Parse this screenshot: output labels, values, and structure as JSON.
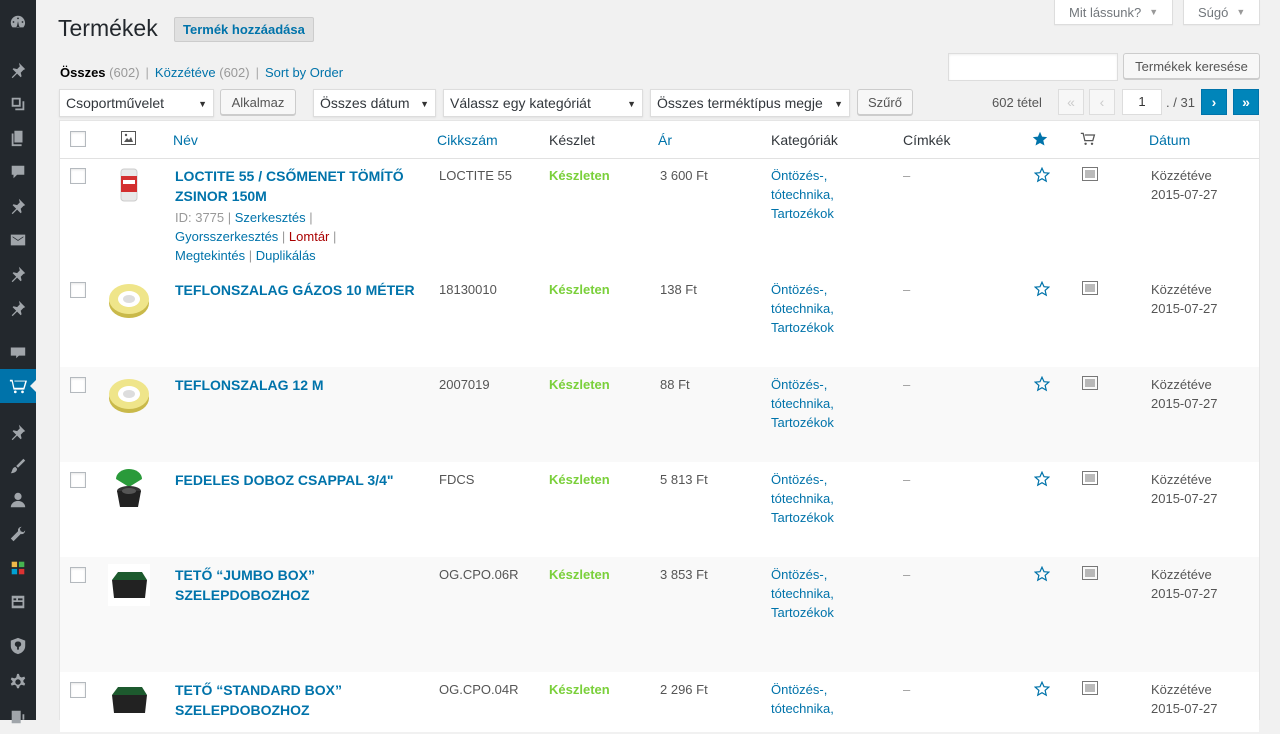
{
  "header": {
    "title": "Termékek",
    "add_new": "Termék hozzáadása",
    "screen_options": "Mit lássunk?",
    "help": "Súgó"
  },
  "views": {
    "all_label": "Összes",
    "all_count": "(602)",
    "published_label": "Közzétéve",
    "published_count": "(602)",
    "sort_label": "Sort by Order"
  },
  "search": {
    "button": "Termékek keresése",
    "value": ""
  },
  "filters": {
    "bulk_action": "Csoportművelet",
    "apply": "Alkalmaz",
    "dates": "Összes dátum",
    "category": "Válassz egy kategóriát",
    "product_type": "Összes terméktípus megje",
    "filter": "Szűrő"
  },
  "pagination": {
    "items": "602 tétel",
    "first": "«",
    "prev": "‹",
    "current_page": "1",
    "total": "/ 31",
    "next": "›",
    "last": "»"
  },
  "columns": {
    "name": "Név",
    "sku": "Cikkszám",
    "stock": "Készlet",
    "price": "Ár",
    "categories": "Kategóriák",
    "tags": "Címkék",
    "date": "Dátum"
  },
  "row_actions": {
    "id": "ID: 3775",
    "edit": "Szerkesztés",
    "quick_edit": "Gyorsszerkesztés",
    "trash": "Lomtár",
    "view": "Megtekintés",
    "duplicate": "Duplikálás"
  },
  "products": [
    {
      "name_1": "LOCTITE 55 / CSŐMENET TÖMÍTŐ",
      "name_2": "ZSINOR 150M",
      "sku": "LOCTITE 55",
      "stock": "Készleten",
      "price": "3 600 Ft",
      "cat_1": "Öntözés-,",
      "cat_2": "tótechnika,",
      "cat_3": "Tartozékok",
      "tags": "–",
      "date_1": "Közzétéve",
      "date_2": "2015-07-27",
      "thumb": "loctite-tube"
    },
    {
      "name_1": "TEFLONSZALAG GÁZOS 10 MÉTER",
      "name_2": "",
      "sku": "18130010",
      "stock": "Készleten",
      "price": "138 Ft",
      "cat_1": "Öntözés-,",
      "cat_2": "tótechnika,",
      "cat_3": "Tartozékok",
      "tags": "–",
      "date_1": "Közzétéve",
      "date_2": "2015-07-27",
      "thumb": "tape-roll"
    },
    {
      "name_1": "TEFLONSZALAG 12 M",
      "name_2": "",
      "sku": "2007019",
      "stock": "Készleten",
      "price": "88 Ft",
      "cat_1": "Öntözés-,",
      "cat_2": "tótechnika,",
      "cat_3": "Tartozékok",
      "tags": "–",
      "date_1": "Közzétéve",
      "date_2": "2015-07-27",
      "thumb": "tape-roll"
    },
    {
      "name_1": "FEDELES DOBOZ CSAPPAL 3/4\"",
      "name_2": "",
      "sku": "FDCS",
      "stock": "Készleten",
      "price": "5 813 Ft",
      "cat_1": "Öntözés-,",
      "cat_2": "tótechnika,",
      "cat_3": "Tartozékok",
      "tags": "–",
      "date_1": "Közzétéve",
      "date_2": "2015-07-27",
      "thumb": "green-valve-box"
    },
    {
      "name_1": "TETŐ “JUMBO BOX”",
      "name_2": "SZELEPDOBOZHOZ",
      "sku": "OG.CPO.06R",
      "stock": "Készleten",
      "price": "3 853 Ft",
      "cat_1": "Öntözés-,",
      "cat_2": "tótechnika,",
      "cat_3": "Tartozékok",
      "tags": "–",
      "date_1": "Közzétéve",
      "date_2": "2015-07-27",
      "thumb": "valve-box-lid"
    },
    {
      "name_1": "TETŐ “STANDARD BOX”",
      "name_2": "SZELEPDOBOZHOZ",
      "sku": "OG.CPO.04R",
      "stock": "Készleten",
      "price": "2 296 Ft",
      "cat_1": "Öntözés-,",
      "cat_2": "tótechnika,",
      "cat_3": "",
      "tags": "–",
      "date_1": "Közzétéve",
      "date_2": "2015-07-27",
      "thumb": "valve-box-lid"
    }
  ],
  "colors": {
    "link": "#0073aa",
    "in_stock": "#7ad03a",
    "sidebar": "#23282d",
    "active": "#0073aa"
  }
}
